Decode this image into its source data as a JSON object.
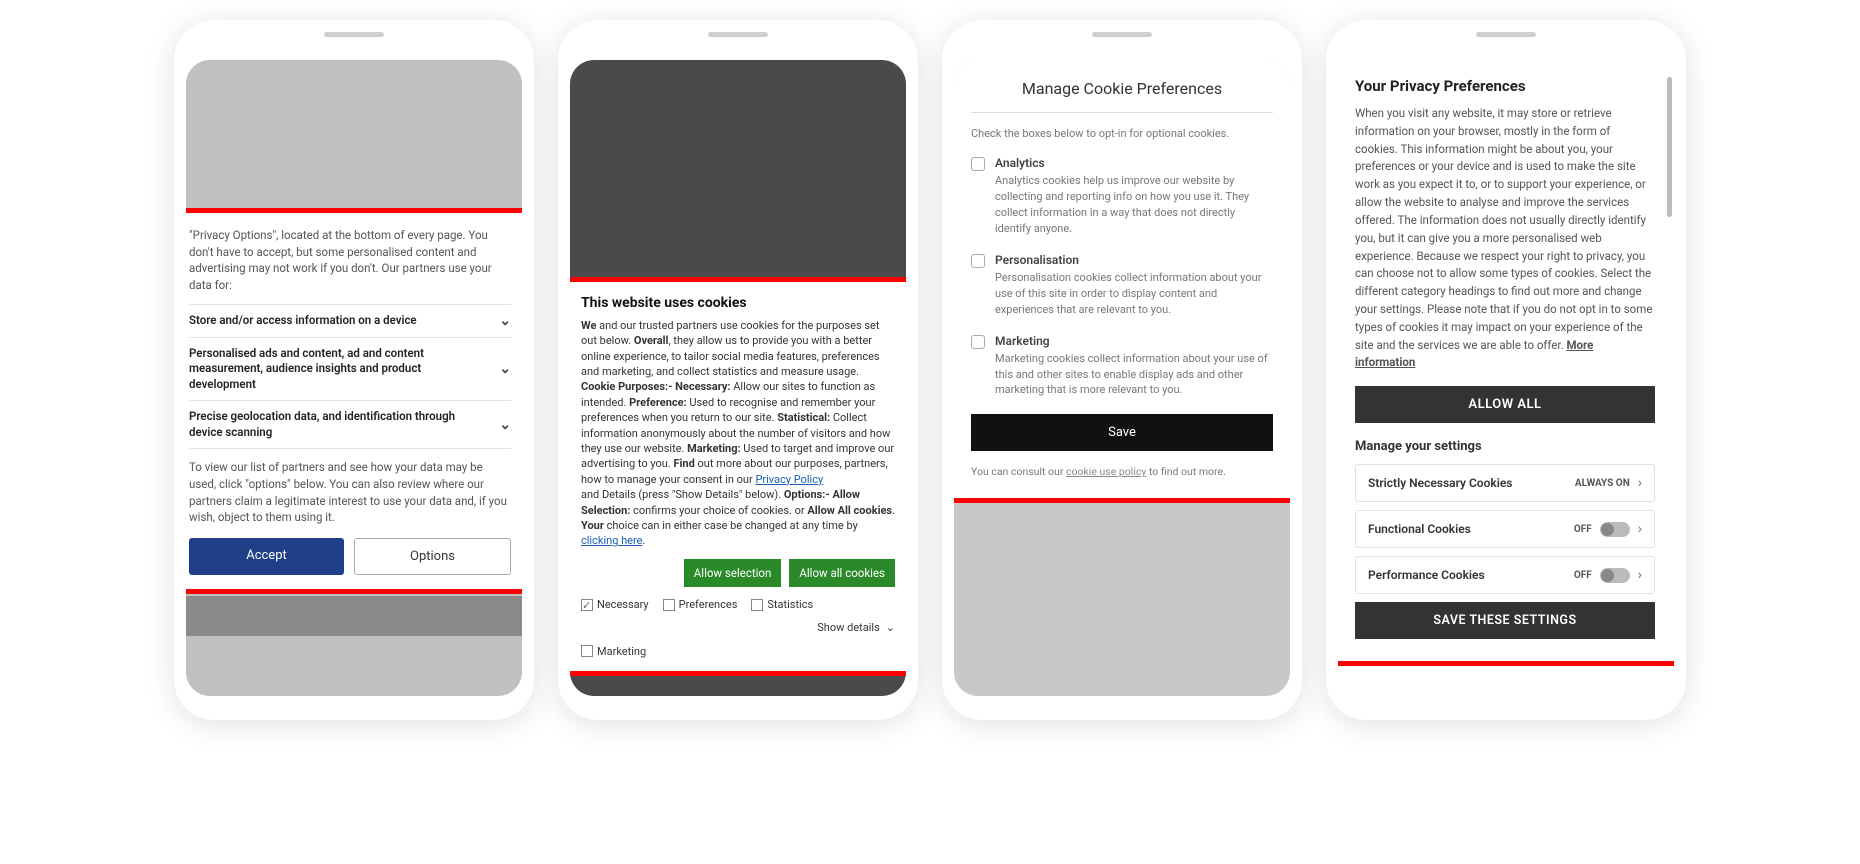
{
  "phone1": {
    "intro": "\"Privacy Options\", located at the bottom of every page. You don't have to accept, but some personalised content and advertising may not work if you don't. Our partners use your data for:",
    "rows": [
      "Store and/or access information on a device",
      "Personalised ads and content, ad and content measurement, audience insights and product development",
      "Precise geolocation data, and identification through device scanning"
    ],
    "footnote": "To view our list of partners and see how your data may be used, click \"options\" below. You can also review where our partners claim a legitimate interest to use your data and, if you wish, object to them using it.",
    "accept": "Accept",
    "options": "Options"
  },
  "phone2": {
    "title": "This website uses cookies",
    "body_html": "<b>We</b> and our trusted partners use cookies for the purposes set out below. <b>Overall</b>, they allow us to provide you with a better online experience, to tailor social media features, preferences and marketing, and collect statistics and measure usage. <b>Cookie Purposes:- Necessary:</b> Allow our sites to function as intended. <b>Preference:</b> Used to recognise and remember your preferences when you return to our site. <b>Statistical:</b> Collect information anonymously about the number of visitors and how they use our website. <b>Marketing:</b> Used to target and improve our advertising to you. <b>Find</b> out more about our purposes, partners, how to manage your consent in our <a>Privacy Policy</a><br>and Details (press \"Show Details\" below). <b>Options:- Allow Selection:</b> confirms your choice of cookies. or <b>Allow All cookies</b>. <b>Your</b> choice can in either case be changed at any time by <a>clicking here</a>.",
    "btn_selection": "Allow selection",
    "btn_all": "Allow all cookies",
    "checks": [
      "Necessary",
      "Preferences",
      "Statistics",
      "Marketing"
    ],
    "show_details": "Show details"
  },
  "phone3": {
    "title": "Manage Cookie Preferences",
    "sub": "Check the boxes below to opt-in for optional cookies.",
    "items": [
      {
        "name": "Analytics",
        "desc": "Analytics cookies help us improve our website by collecting and reporting info on how you use it. They collect information in a way that does not directly identify anyone."
      },
      {
        "name": "Personalisation",
        "desc": "Personalisation cookies collect information about your use of this site in order to display content and experiences that are relevant to you."
      },
      {
        "name": "Marketing",
        "desc": "Marketing cookies collect information about your use of this and other sites to enable display ads and other marketing that is more relevant to you."
      }
    ],
    "save": "Save",
    "foot_pre": "You can consult our ",
    "foot_link": "cookie use policy",
    "foot_post": " to find out more."
  },
  "phone4": {
    "title": "Your Privacy Preferences",
    "body": "When you visit any website, it may store or retrieve information on your browser, mostly in the form of cookies. This information might be about you, your preferences or your device and is used to make the site work as you expect it to, or to support your experience, or allow the website to analyse and improve the services offered. The information does not usually directly identify you, but it can give you a more personalised web experience. Because we respect your right to privacy, you can choose not to allow some types of cookies. Select the different category headings to find out more and change your settings. Please note that if you do not opt in to some types of cookies it may impact on your experience of the site and the services we are able to offer.  ",
    "more": "More information",
    "allow_all": "ALLOW ALL",
    "manage": "Manage your settings",
    "rows": [
      {
        "label": "Strictly Necessary Cookies",
        "status": "ALWAYS ON",
        "toggle": false
      },
      {
        "label": "Functional Cookies",
        "status": "OFF",
        "toggle": true
      },
      {
        "label": "Performance Cookies",
        "status": "OFF",
        "toggle": true
      }
    ],
    "save": "SAVE THESE SETTINGS"
  }
}
